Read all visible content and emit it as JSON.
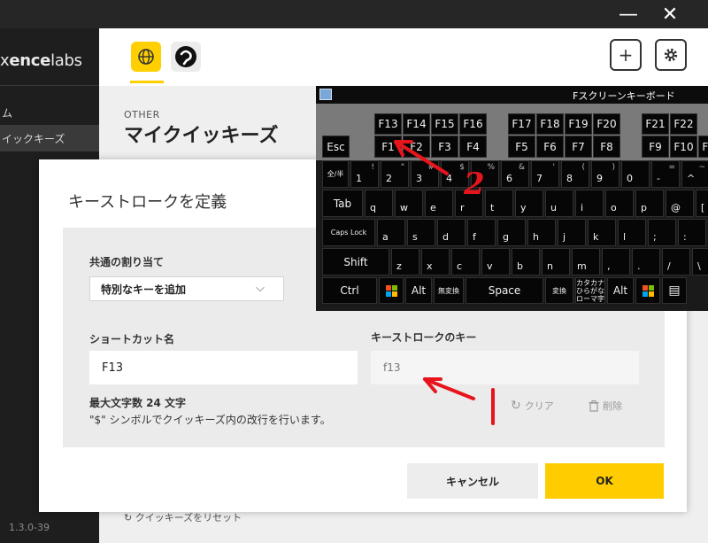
{
  "window": {
    "minimize": "—",
    "close": "✕"
  },
  "sidebar": {
    "logo_prefix": "x",
    "logo_bold": "ence",
    "logo_suffix": "labs",
    "items": [
      {
        "label": "ム",
        "selected": false
      },
      {
        "label": "イックキーズ",
        "selected": true
      }
    ],
    "version": "1.3.0-39"
  },
  "header": {
    "apps": [
      {
        "name": "globe",
        "icon": "globe-icon",
        "color": "#ffcf00"
      },
      {
        "name": "clip-studio",
        "icon": "clip-studio-icon",
        "color": "#ececec"
      }
    ],
    "add_button": "+",
    "settings_icon": "gear-icon"
  },
  "page": {
    "section": "OTHER",
    "title": "マイクイッキーズ",
    "reset_link": "クイッキーズをリセット"
  },
  "dialog": {
    "title": "キーストロークを定義",
    "assign_label": "共通の割り当て",
    "assign_value": "特別なキーを追加",
    "shortcut_label": "ショートカット名",
    "shortcut_value": "F13",
    "keystroke_label": "キーストロークのキー",
    "keystroke_value": "f13",
    "hint_max": "最大文字数 24 文字",
    "hint_newline": "\"$\" シンボルでクイッキーズ内の改行を行います。",
    "clear": "クリア",
    "delete": "削除",
    "cancel": "キャンセル",
    "ok": "OK"
  },
  "keyboard": {
    "title": "Fスクリーンキーボード",
    "row_f_top": [
      "F13",
      "F14",
      "F15",
      "F16",
      "F17",
      "F18",
      "F19",
      "F20",
      "F21",
      "F22"
    ],
    "row_f_main": [
      "Esc",
      "F1",
      "F2",
      "F3",
      "F4",
      "F5",
      "F6",
      "F7",
      "F8",
      "F9",
      "F10",
      "F11"
    ],
    "row_num": [
      {
        "k": "全/半",
        "s": ""
      },
      {
        "k": "1",
        "s": "!"
      },
      {
        "k": "2",
        "s": "\""
      },
      {
        "k": "3",
        "s": "#"
      },
      {
        "k": "4",
        "s": "$"
      },
      {
        "k": "5",
        "s": "%"
      },
      {
        "k": "6",
        "s": "&"
      },
      {
        "k": "7",
        "s": "'"
      },
      {
        "k": "8",
        "s": "("
      },
      {
        "k": "9",
        "s": ")"
      },
      {
        "k": "0",
        "s": ""
      },
      {
        "k": "-",
        "s": "="
      },
      {
        "k": "^",
        "s": "~"
      },
      {
        "k": "¥",
        "s": "|"
      }
    ],
    "row_q": [
      "Tab",
      "q",
      "w",
      "e",
      "r",
      "t",
      "y",
      "u",
      "i",
      "o",
      "p",
      "@",
      "["
    ],
    "row_a": [
      "Caps Lock",
      "a",
      "s",
      "d",
      "f",
      "g",
      "h",
      "j",
      "k",
      "l",
      ";",
      ":",
      "]"
    ],
    "row_z": [
      "Shift",
      "z",
      "x",
      "c",
      "v",
      "b",
      "n",
      "m",
      ",",
      ".",
      "/",
      "\\"
    ],
    "row_bottom": [
      "Ctrl",
      "win",
      "Alt",
      "無変換",
      "Space",
      "変換",
      "カタカナ ひらがな ローマ字",
      "Alt",
      "win",
      "menu"
    ]
  },
  "annotations": {
    "step_number": "2",
    "color": "#e8141c"
  }
}
